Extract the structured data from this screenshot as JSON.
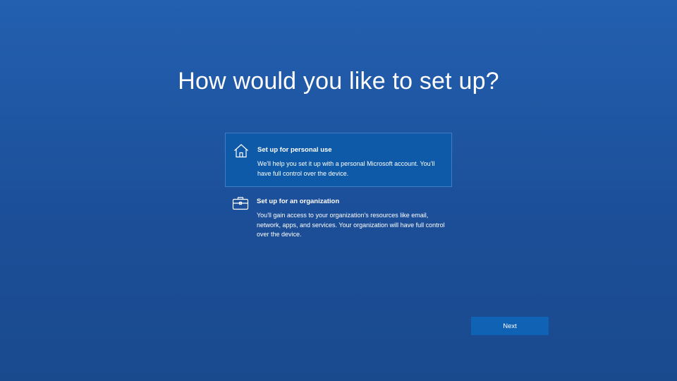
{
  "page": {
    "title": "How would you like to set up?"
  },
  "options": [
    {
      "icon": "home-icon",
      "title": "Set up for personal use",
      "description": "We'll help you set it up with a personal Microsoft account. You'll have full control over the device.",
      "selected": true
    },
    {
      "icon": "briefcase-icon",
      "title": "Set up for an organization",
      "description": "You'll gain access to your organization's resources like email, network, apps, and services. Your organization will have full control over the device.",
      "selected": false
    }
  ],
  "footer": {
    "next_label": "Next"
  },
  "colors": {
    "background": "#1f57a4",
    "selected_option_bg": "#0e5aa8",
    "button_bg": "#1062b4",
    "text": "#ffffff"
  }
}
